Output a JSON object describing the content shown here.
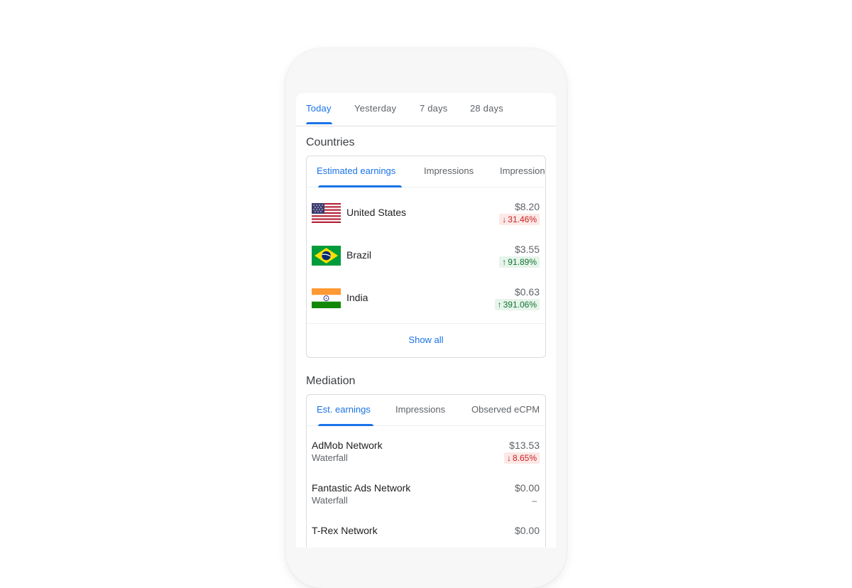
{
  "date_tabs": [
    "Today",
    "Yesterday",
    "7 days",
    "28 days"
  ],
  "countries": {
    "title": "Countries",
    "tabs": [
      "Estimated earnings",
      "Impressions",
      "Impressions"
    ],
    "rows": [
      {
        "name": "United States",
        "amount": "$8.20",
        "change": "31.46%",
        "direction": "down",
        "flag_icon": "us-flag-icon"
      },
      {
        "name": "Brazil",
        "amount": "$3.55",
        "change": "91.89%",
        "direction": "up",
        "flag_icon": "brazil-flag-icon"
      },
      {
        "name": "India",
        "amount": "$0.63",
        "change": "391.06%",
        "direction": "up",
        "flag_icon": "india-flag-icon"
      }
    ],
    "show_all": "Show all"
  },
  "mediation": {
    "title": "Mediation",
    "tabs": [
      "Est. earnings",
      "Impressions",
      "Observed eCPM"
    ],
    "rows": [
      {
        "name": "AdMob Network",
        "type": "Waterfall",
        "amount": "$13.53",
        "change": "8.65%",
        "direction": "down"
      },
      {
        "name": "Fantastic Ads Network",
        "type": "Waterfall",
        "amount": "$0.00",
        "change": "–",
        "direction": "neutral"
      },
      {
        "name": "T-Rex Network",
        "type": "",
        "amount": "$0.00",
        "change": "",
        "direction": "neutral"
      }
    ]
  },
  "colors": {
    "accent": "#1a73e8",
    "negative": "#c5221f",
    "negative_bg": "#fce8e6",
    "positive": "#137333",
    "positive_bg": "#e6f4ea"
  }
}
